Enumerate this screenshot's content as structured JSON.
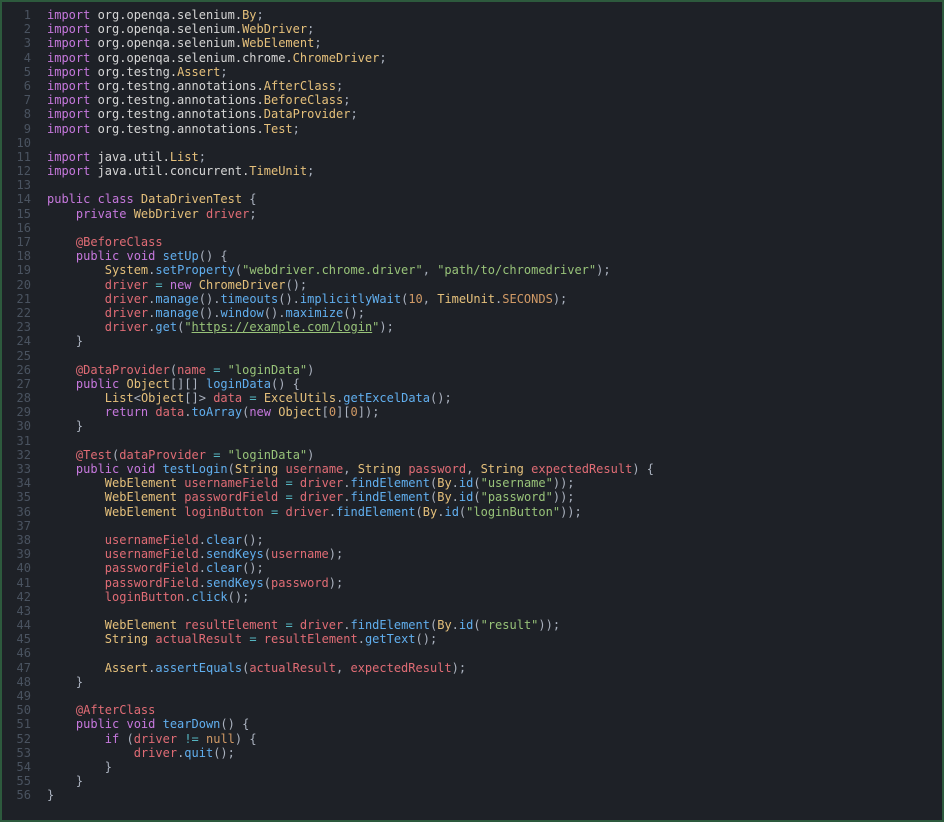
{
  "editor": {
    "background": "#1e2127",
    "border": "#2d5a3d",
    "gutter_color": "#4a5360"
  },
  "lines": [
    [
      [
        "kw",
        "import "
      ],
      [
        "ns",
        "org.openqa.selenium."
      ],
      [
        "typ",
        "By"
      ],
      [
        "pun",
        ";"
      ]
    ],
    [
      [
        "kw",
        "import "
      ],
      [
        "ns",
        "org.openqa.selenium."
      ],
      [
        "typ",
        "WebDriver"
      ],
      [
        "pun",
        ";"
      ]
    ],
    [
      [
        "kw",
        "import "
      ],
      [
        "ns",
        "org.openqa.selenium."
      ],
      [
        "typ",
        "WebElement"
      ],
      [
        "pun",
        ";"
      ]
    ],
    [
      [
        "kw",
        "import "
      ],
      [
        "ns",
        "org.openqa.selenium.chrome."
      ],
      [
        "typ",
        "ChromeDriver"
      ],
      [
        "pun",
        ";"
      ]
    ],
    [
      [
        "kw",
        "import "
      ],
      [
        "ns",
        "org.testng."
      ],
      [
        "typ",
        "Assert"
      ],
      [
        "pun",
        ";"
      ]
    ],
    [
      [
        "kw",
        "import "
      ],
      [
        "ns",
        "org.testng.annotations."
      ],
      [
        "typ",
        "AfterClass"
      ],
      [
        "pun",
        ";"
      ]
    ],
    [
      [
        "kw",
        "import "
      ],
      [
        "ns",
        "org.testng.annotations."
      ],
      [
        "typ",
        "BeforeClass"
      ],
      [
        "pun",
        ";"
      ]
    ],
    [
      [
        "kw",
        "import "
      ],
      [
        "ns",
        "org.testng.annotations."
      ],
      [
        "typ",
        "DataProvider"
      ],
      [
        "pun",
        ";"
      ]
    ],
    [
      [
        "kw",
        "import "
      ],
      [
        "ns",
        "org.testng.annotations."
      ],
      [
        "typ",
        "Test"
      ],
      [
        "pun",
        ";"
      ]
    ],
    [],
    [
      [
        "kw",
        "import "
      ],
      [
        "ns",
        "java.util."
      ],
      [
        "typ",
        "List"
      ],
      [
        "pun",
        ";"
      ]
    ],
    [
      [
        "kw",
        "import "
      ],
      [
        "ns",
        "java.util.concurrent."
      ],
      [
        "typ",
        "TimeUnit"
      ],
      [
        "pun",
        ";"
      ]
    ],
    [],
    [
      [
        "kw",
        "public class "
      ],
      [
        "typ",
        "DataDrivenTest"
      ],
      [
        "pun",
        " {"
      ]
    ],
    [
      [
        "pun",
        "    "
      ],
      [
        "kw",
        "private "
      ],
      [
        "typ",
        "WebDriver"
      ],
      [
        "pun",
        " "
      ],
      [
        "id",
        "driver"
      ],
      [
        "pun",
        ";"
      ]
    ],
    [],
    [
      [
        "pun",
        "    "
      ],
      [
        "ann",
        "@BeforeClass"
      ]
    ],
    [
      [
        "pun",
        "    "
      ],
      [
        "kw",
        "public void "
      ],
      [
        "fn",
        "setUp"
      ],
      [
        "pun",
        "() {"
      ]
    ],
    [
      [
        "pun",
        "        "
      ],
      [
        "typ",
        "System"
      ],
      [
        "pun",
        "."
      ],
      [
        "fn",
        "setProperty"
      ],
      [
        "pun",
        "("
      ],
      [
        "str",
        "\"webdriver.chrome.driver\""
      ],
      [
        "pun",
        ", "
      ],
      [
        "str",
        "\"path/to/chromedriver\""
      ],
      [
        "pun",
        ");"
      ]
    ],
    [
      [
        "pun",
        "        "
      ],
      [
        "id",
        "driver"
      ],
      [
        "pun",
        " "
      ],
      [
        "op",
        "="
      ],
      [
        "pun",
        " "
      ],
      [
        "kw",
        "new "
      ],
      [
        "typ",
        "ChromeDriver"
      ],
      [
        "pun",
        "();"
      ]
    ],
    [
      [
        "pun",
        "        "
      ],
      [
        "id",
        "driver"
      ],
      [
        "pun",
        "."
      ],
      [
        "fn",
        "manage"
      ],
      [
        "pun",
        "()."
      ],
      [
        "fn",
        "timeouts"
      ],
      [
        "pun",
        "()."
      ],
      [
        "fn",
        "implicitlyWait"
      ],
      [
        "pun",
        "("
      ],
      [
        "num",
        "10"
      ],
      [
        "pun",
        ", "
      ],
      [
        "typ",
        "TimeUnit"
      ],
      [
        "pun",
        "."
      ],
      [
        "cst",
        "SECONDS"
      ],
      [
        "pun",
        ");"
      ]
    ],
    [
      [
        "pun",
        "        "
      ],
      [
        "id",
        "driver"
      ],
      [
        "pun",
        "."
      ],
      [
        "fn",
        "manage"
      ],
      [
        "pun",
        "()."
      ],
      [
        "fn",
        "window"
      ],
      [
        "pun",
        "()."
      ],
      [
        "fn",
        "maximize"
      ],
      [
        "pun",
        "();"
      ]
    ],
    [
      [
        "pun",
        "        "
      ],
      [
        "id",
        "driver"
      ],
      [
        "pun",
        "."
      ],
      [
        "fn",
        "get"
      ],
      [
        "pun",
        "("
      ],
      [
        "str",
        "\""
      ],
      [
        "url",
        "https://example.com/login"
      ],
      [
        "str",
        "\""
      ],
      [
        "pun",
        ");"
      ]
    ],
    [
      [
        "pun",
        "    }"
      ]
    ],
    [],
    [
      [
        "pun",
        "    "
      ],
      [
        "ann",
        "@DataProvider"
      ],
      [
        "pun",
        "("
      ],
      [
        "id",
        "name"
      ],
      [
        "pun",
        " "
      ],
      [
        "op",
        "="
      ],
      [
        "pun",
        " "
      ],
      [
        "str",
        "\"loginData\""
      ],
      [
        "pun",
        ")"
      ]
    ],
    [
      [
        "pun",
        "    "
      ],
      [
        "kw",
        "public "
      ],
      [
        "typ",
        "Object"
      ],
      [
        "pun",
        "[][] "
      ],
      [
        "fn",
        "loginData"
      ],
      [
        "pun",
        "() {"
      ]
    ],
    [
      [
        "pun",
        "        "
      ],
      [
        "typ",
        "List"
      ],
      [
        "pun",
        "<"
      ],
      [
        "typ",
        "Object"
      ],
      [
        "pun",
        "[]> "
      ],
      [
        "id",
        "data"
      ],
      [
        "pun",
        " "
      ],
      [
        "op",
        "="
      ],
      [
        "pun",
        " "
      ],
      [
        "typ",
        "ExcelUtils"
      ],
      [
        "pun",
        "."
      ],
      [
        "fn",
        "getExcelData"
      ],
      [
        "pun",
        "();"
      ]
    ],
    [
      [
        "pun",
        "        "
      ],
      [
        "kw",
        "return "
      ],
      [
        "id",
        "data"
      ],
      [
        "pun",
        "."
      ],
      [
        "fn",
        "toArray"
      ],
      [
        "pun",
        "("
      ],
      [
        "kw",
        "new "
      ],
      [
        "typ",
        "Object"
      ],
      [
        "pun",
        "["
      ],
      [
        "num",
        "0"
      ],
      [
        "pun",
        "]["
      ],
      [
        "num",
        "0"
      ],
      [
        "pun",
        "]);"
      ]
    ],
    [
      [
        "pun",
        "    }"
      ]
    ],
    [],
    [
      [
        "pun",
        "    "
      ],
      [
        "ann",
        "@Test"
      ],
      [
        "pun",
        "("
      ],
      [
        "id",
        "dataProvider"
      ],
      [
        "pun",
        " "
      ],
      [
        "op",
        "="
      ],
      [
        "pun",
        " "
      ],
      [
        "str",
        "\"loginData\""
      ],
      [
        "pun",
        ")"
      ]
    ],
    [
      [
        "pun",
        "    "
      ],
      [
        "kw",
        "public void "
      ],
      [
        "fn",
        "testLogin"
      ],
      [
        "pun",
        "("
      ],
      [
        "typ",
        "String"
      ],
      [
        "pun",
        " "
      ],
      [
        "id",
        "username"
      ],
      [
        "pun",
        ", "
      ],
      [
        "typ",
        "String"
      ],
      [
        "pun",
        " "
      ],
      [
        "id",
        "password"
      ],
      [
        "pun",
        ", "
      ],
      [
        "typ",
        "String"
      ],
      [
        "pun",
        " "
      ],
      [
        "id",
        "expectedResult"
      ],
      [
        "pun",
        ") {"
      ]
    ],
    [
      [
        "pun",
        "        "
      ],
      [
        "typ",
        "WebElement"
      ],
      [
        "pun",
        " "
      ],
      [
        "id",
        "usernameField"
      ],
      [
        "pun",
        " "
      ],
      [
        "op",
        "="
      ],
      [
        "pun",
        " "
      ],
      [
        "id",
        "driver"
      ],
      [
        "pun",
        "."
      ],
      [
        "fn",
        "findElement"
      ],
      [
        "pun",
        "("
      ],
      [
        "typ",
        "By"
      ],
      [
        "pun",
        "."
      ],
      [
        "fn",
        "id"
      ],
      [
        "pun",
        "("
      ],
      [
        "str",
        "\"username\""
      ],
      [
        "pun",
        "));"
      ]
    ],
    [
      [
        "pun",
        "        "
      ],
      [
        "typ",
        "WebElement"
      ],
      [
        "pun",
        " "
      ],
      [
        "id",
        "passwordField"
      ],
      [
        "pun",
        " "
      ],
      [
        "op",
        "="
      ],
      [
        "pun",
        " "
      ],
      [
        "id",
        "driver"
      ],
      [
        "pun",
        "."
      ],
      [
        "fn",
        "findElement"
      ],
      [
        "pun",
        "("
      ],
      [
        "typ",
        "By"
      ],
      [
        "pun",
        "."
      ],
      [
        "fn",
        "id"
      ],
      [
        "pun",
        "("
      ],
      [
        "str",
        "\"password\""
      ],
      [
        "pun",
        "));"
      ]
    ],
    [
      [
        "pun",
        "        "
      ],
      [
        "typ",
        "WebElement"
      ],
      [
        "pun",
        " "
      ],
      [
        "id",
        "loginButton"
      ],
      [
        "pun",
        " "
      ],
      [
        "op",
        "="
      ],
      [
        "pun",
        " "
      ],
      [
        "id",
        "driver"
      ],
      [
        "pun",
        "."
      ],
      [
        "fn",
        "findElement"
      ],
      [
        "pun",
        "("
      ],
      [
        "typ",
        "By"
      ],
      [
        "pun",
        "."
      ],
      [
        "fn",
        "id"
      ],
      [
        "pun",
        "("
      ],
      [
        "str",
        "\"loginButton\""
      ],
      [
        "pun",
        "));"
      ]
    ],
    [],
    [
      [
        "pun",
        "        "
      ],
      [
        "id",
        "usernameField"
      ],
      [
        "pun",
        "."
      ],
      [
        "fn",
        "clear"
      ],
      [
        "pun",
        "();"
      ]
    ],
    [
      [
        "pun",
        "        "
      ],
      [
        "id",
        "usernameField"
      ],
      [
        "pun",
        "."
      ],
      [
        "fn",
        "sendKeys"
      ],
      [
        "pun",
        "("
      ],
      [
        "id",
        "username"
      ],
      [
        "pun",
        ");"
      ]
    ],
    [
      [
        "pun",
        "        "
      ],
      [
        "id",
        "passwordField"
      ],
      [
        "pun",
        "."
      ],
      [
        "fn",
        "clear"
      ],
      [
        "pun",
        "();"
      ]
    ],
    [
      [
        "pun",
        "        "
      ],
      [
        "id",
        "passwordField"
      ],
      [
        "pun",
        "."
      ],
      [
        "fn",
        "sendKeys"
      ],
      [
        "pun",
        "("
      ],
      [
        "id",
        "password"
      ],
      [
        "pun",
        ");"
      ]
    ],
    [
      [
        "pun",
        "        "
      ],
      [
        "id",
        "loginButton"
      ],
      [
        "pun",
        "."
      ],
      [
        "fn",
        "click"
      ],
      [
        "pun",
        "();"
      ]
    ],
    [],
    [
      [
        "pun",
        "        "
      ],
      [
        "typ",
        "WebElement"
      ],
      [
        "pun",
        " "
      ],
      [
        "id",
        "resultElement"
      ],
      [
        "pun",
        " "
      ],
      [
        "op",
        "="
      ],
      [
        "pun",
        " "
      ],
      [
        "id",
        "driver"
      ],
      [
        "pun",
        "."
      ],
      [
        "fn",
        "findElement"
      ],
      [
        "pun",
        "("
      ],
      [
        "typ",
        "By"
      ],
      [
        "pun",
        "."
      ],
      [
        "fn",
        "id"
      ],
      [
        "pun",
        "("
      ],
      [
        "str",
        "\"result\""
      ],
      [
        "pun",
        "));"
      ]
    ],
    [
      [
        "pun",
        "        "
      ],
      [
        "typ",
        "String"
      ],
      [
        "pun",
        " "
      ],
      [
        "id",
        "actualResult"
      ],
      [
        "pun",
        " "
      ],
      [
        "op",
        "="
      ],
      [
        "pun",
        " "
      ],
      [
        "id",
        "resultElement"
      ],
      [
        "pun",
        "."
      ],
      [
        "fn",
        "getText"
      ],
      [
        "pun",
        "();"
      ]
    ],
    [],
    [
      [
        "pun",
        "        "
      ],
      [
        "typ",
        "Assert"
      ],
      [
        "pun",
        "."
      ],
      [
        "fn",
        "assertEquals"
      ],
      [
        "pun",
        "("
      ],
      [
        "id",
        "actualResult"
      ],
      [
        "pun",
        ", "
      ],
      [
        "id",
        "expectedResult"
      ],
      [
        "pun",
        ");"
      ]
    ],
    [
      [
        "pun",
        "    }"
      ]
    ],
    [],
    [
      [
        "pun",
        "    "
      ],
      [
        "ann",
        "@AfterClass"
      ]
    ],
    [
      [
        "pun",
        "    "
      ],
      [
        "kw",
        "public void "
      ],
      [
        "fn",
        "tearDown"
      ],
      [
        "pun",
        "() {"
      ]
    ],
    [
      [
        "pun",
        "        "
      ],
      [
        "kw",
        "if "
      ],
      [
        "pun",
        "("
      ],
      [
        "id",
        "driver"
      ],
      [
        "pun",
        " "
      ],
      [
        "op",
        "!="
      ],
      [
        "pun",
        " "
      ],
      [
        "nul",
        "null"
      ],
      [
        "pun",
        ") {"
      ]
    ],
    [
      [
        "pun",
        "            "
      ],
      [
        "id",
        "driver"
      ],
      [
        "pun",
        "."
      ],
      [
        "fn",
        "quit"
      ],
      [
        "pun",
        "();"
      ]
    ],
    [
      [
        "pun",
        "        }"
      ]
    ],
    [
      [
        "pun",
        "    }"
      ]
    ],
    [
      [
        "pun",
        "}"
      ]
    ]
  ]
}
